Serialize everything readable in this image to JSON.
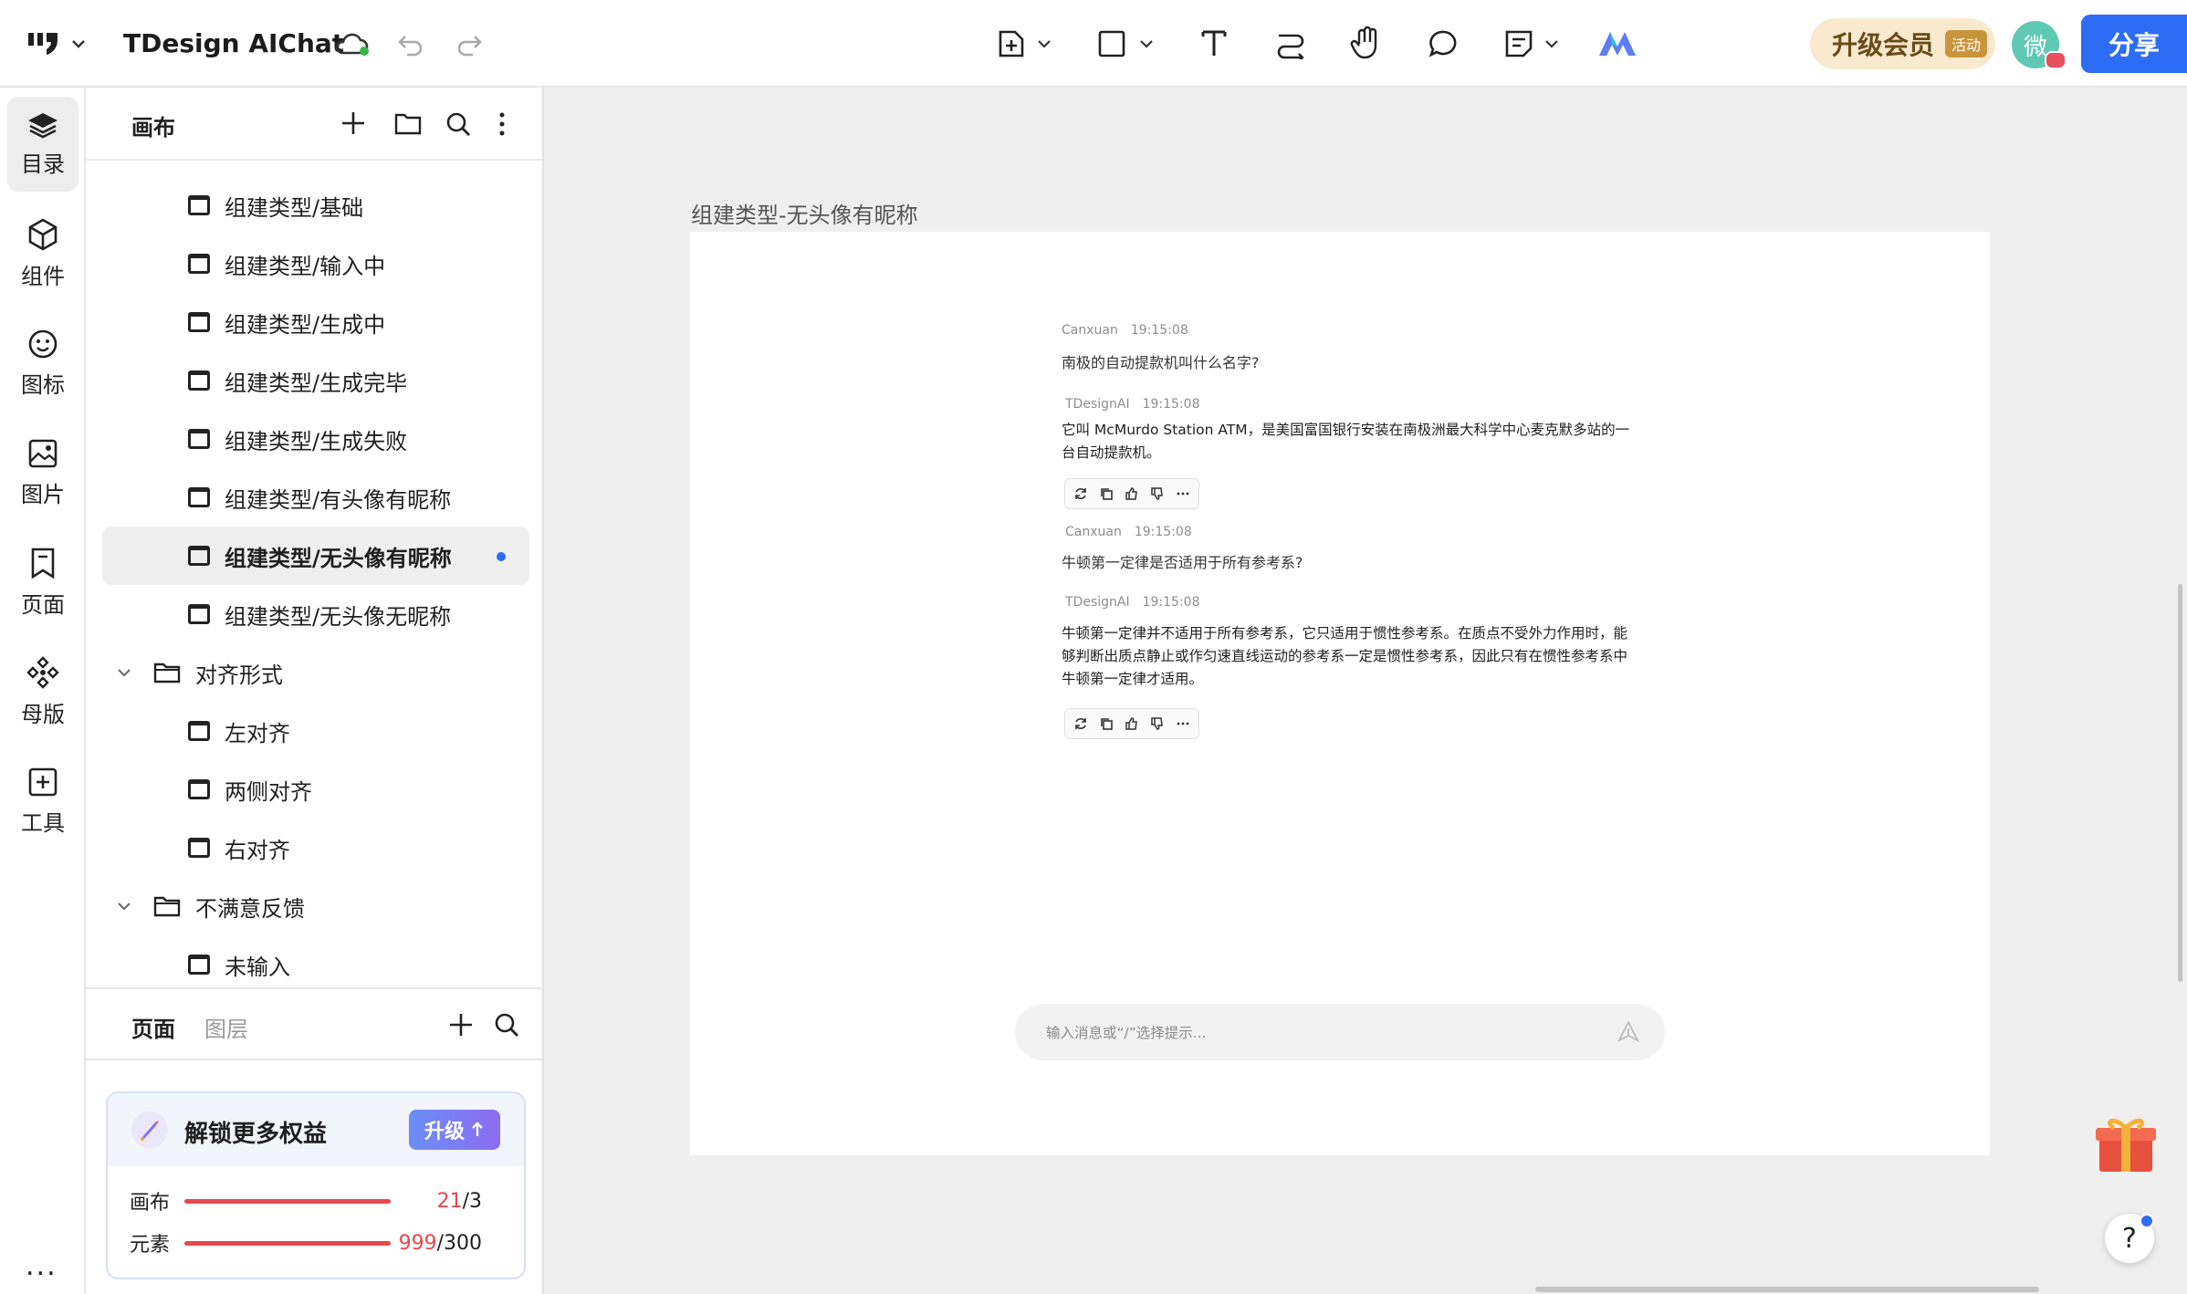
{
  "app": {
    "title": "TDesign AIChat"
  },
  "topbar": {
    "upgrade_label": "升级会员",
    "upgrade_tag": "活动",
    "avatar_text": "微",
    "share_label": "分享"
  },
  "rail": {
    "items": [
      {
        "label": "目录",
        "icon": "layers-icon"
      },
      {
        "label": "组件",
        "icon": "component-icon"
      },
      {
        "label": "图标",
        "icon": "smiley-icon"
      },
      {
        "label": "图片",
        "icon": "image-icon"
      },
      {
        "label": "页面",
        "icon": "bookmark-icon"
      },
      {
        "label": "母版",
        "icon": "master-icon"
      },
      {
        "label": "工具",
        "icon": "tools-icon"
      }
    ],
    "more": "..."
  },
  "panel": {
    "title": "画布",
    "tree": [
      {
        "type": "page",
        "label": "组建类型/基础"
      },
      {
        "type": "page",
        "label": "组建类型/输入中"
      },
      {
        "type": "page",
        "label": "组建类型/生成中"
      },
      {
        "type": "page",
        "label": "组建类型/生成完毕"
      },
      {
        "type": "page",
        "label": "组建类型/生成失败"
      },
      {
        "type": "page",
        "label": "组建类型/有头像有昵称"
      },
      {
        "type": "page",
        "label": "组建类型/无头像有昵称",
        "selected": true
      },
      {
        "type": "page",
        "label": "组建类型/无头像无昵称"
      },
      {
        "type": "folder",
        "label": "对齐形式"
      },
      {
        "type": "page",
        "label": "左对齐"
      },
      {
        "type": "page",
        "label": "两侧对齐"
      },
      {
        "type": "page",
        "label": "右对齐"
      },
      {
        "type": "folder",
        "label": "不满意反馈"
      },
      {
        "type": "page",
        "label": "未输入"
      }
    ],
    "tabs": {
      "pages": "页面",
      "layers": "图层"
    },
    "unlock": {
      "title": "解锁更多权益",
      "button": "升级",
      "quota": [
        {
          "label": "画布",
          "used": "21",
          "total": "/3"
        },
        {
          "label": "元素",
          "used": "999",
          "total": "/300"
        }
      ]
    }
  },
  "canvas": {
    "frame_title": "组建类型-无头像有昵称",
    "messages": [
      {
        "role": "user",
        "name": "Canxuan",
        "time": "19:15:08",
        "text": "南极的自动提款机叫什么名字?"
      },
      {
        "role": "ai",
        "name": "TDesignAI",
        "time": "19:15:08",
        "lines": [
          "它叫 McMurdo Station ATM，是美国富国银行安装在南极洲最大科学中心麦克默多站的一",
          "台自动提款机。"
        ]
      },
      {
        "role": "user",
        "name": "Canxuan",
        "time": "19:15:08",
        "text": "牛顿第一定律是否适用于所有参考系?"
      },
      {
        "role": "ai",
        "name": "TDesignAI",
        "time": "19:15:08",
        "lines": [
          "牛顿第一定律并不适用于所有参考系，它只适用于惯性参考系。在质点不受外力作用时，能",
          "够判断出质点静止或作匀速直线运动的参考系一定是惯性参考系，因此只有在惯性参考系中",
          "牛顿第一定律才适用。"
        ]
      }
    ],
    "input_placeholder": "输入消息或“/”选择提示..."
  },
  "help": "?"
}
